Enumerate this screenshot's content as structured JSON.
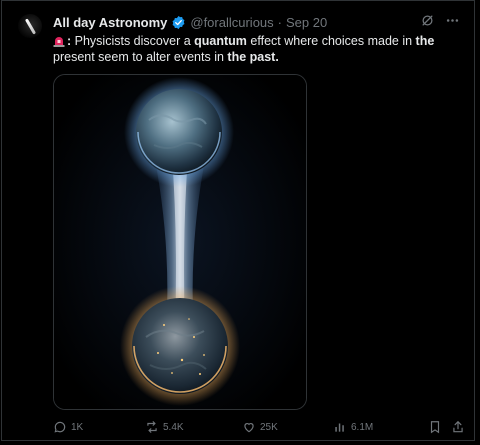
{
  "post": {
    "author_name": "All day Astronomy",
    "handle": "@forallcurious",
    "separator": "·",
    "date": "Sep 20",
    "text_parts": {
      "colon": ":",
      "p1": " Physicists discover a ",
      "b1": "quantum",
      "p2": " effect where choices made in ",
      "b2": "the",
      "p3": " present seem to alter events in ",
      "b3": "the past."
    }
  },
  "actions": {
    "replies": "1K",
    "reposts": "5.4K",
    "likes": "25K",
    "views": "6.1M"
  },
  "icons": {
    "verified": "verified-badge-icon",
    "grok": "grok-icon",
    "more": "more-icon",
    "reply": "reply-icon",
    "repost": "repost-icon",
    "like": "like-icon",
    "views": "views-icon",
    "bookmark": "bookmark-icon",
    "share": "share-icon"
  },
  "colors": {
    "background": "#000000",
    "text": "#e7e9ea",
    "muted": "#71767b",
    "verified": "#1d9bf0",
    "border": "#2f3336"
  }
}
